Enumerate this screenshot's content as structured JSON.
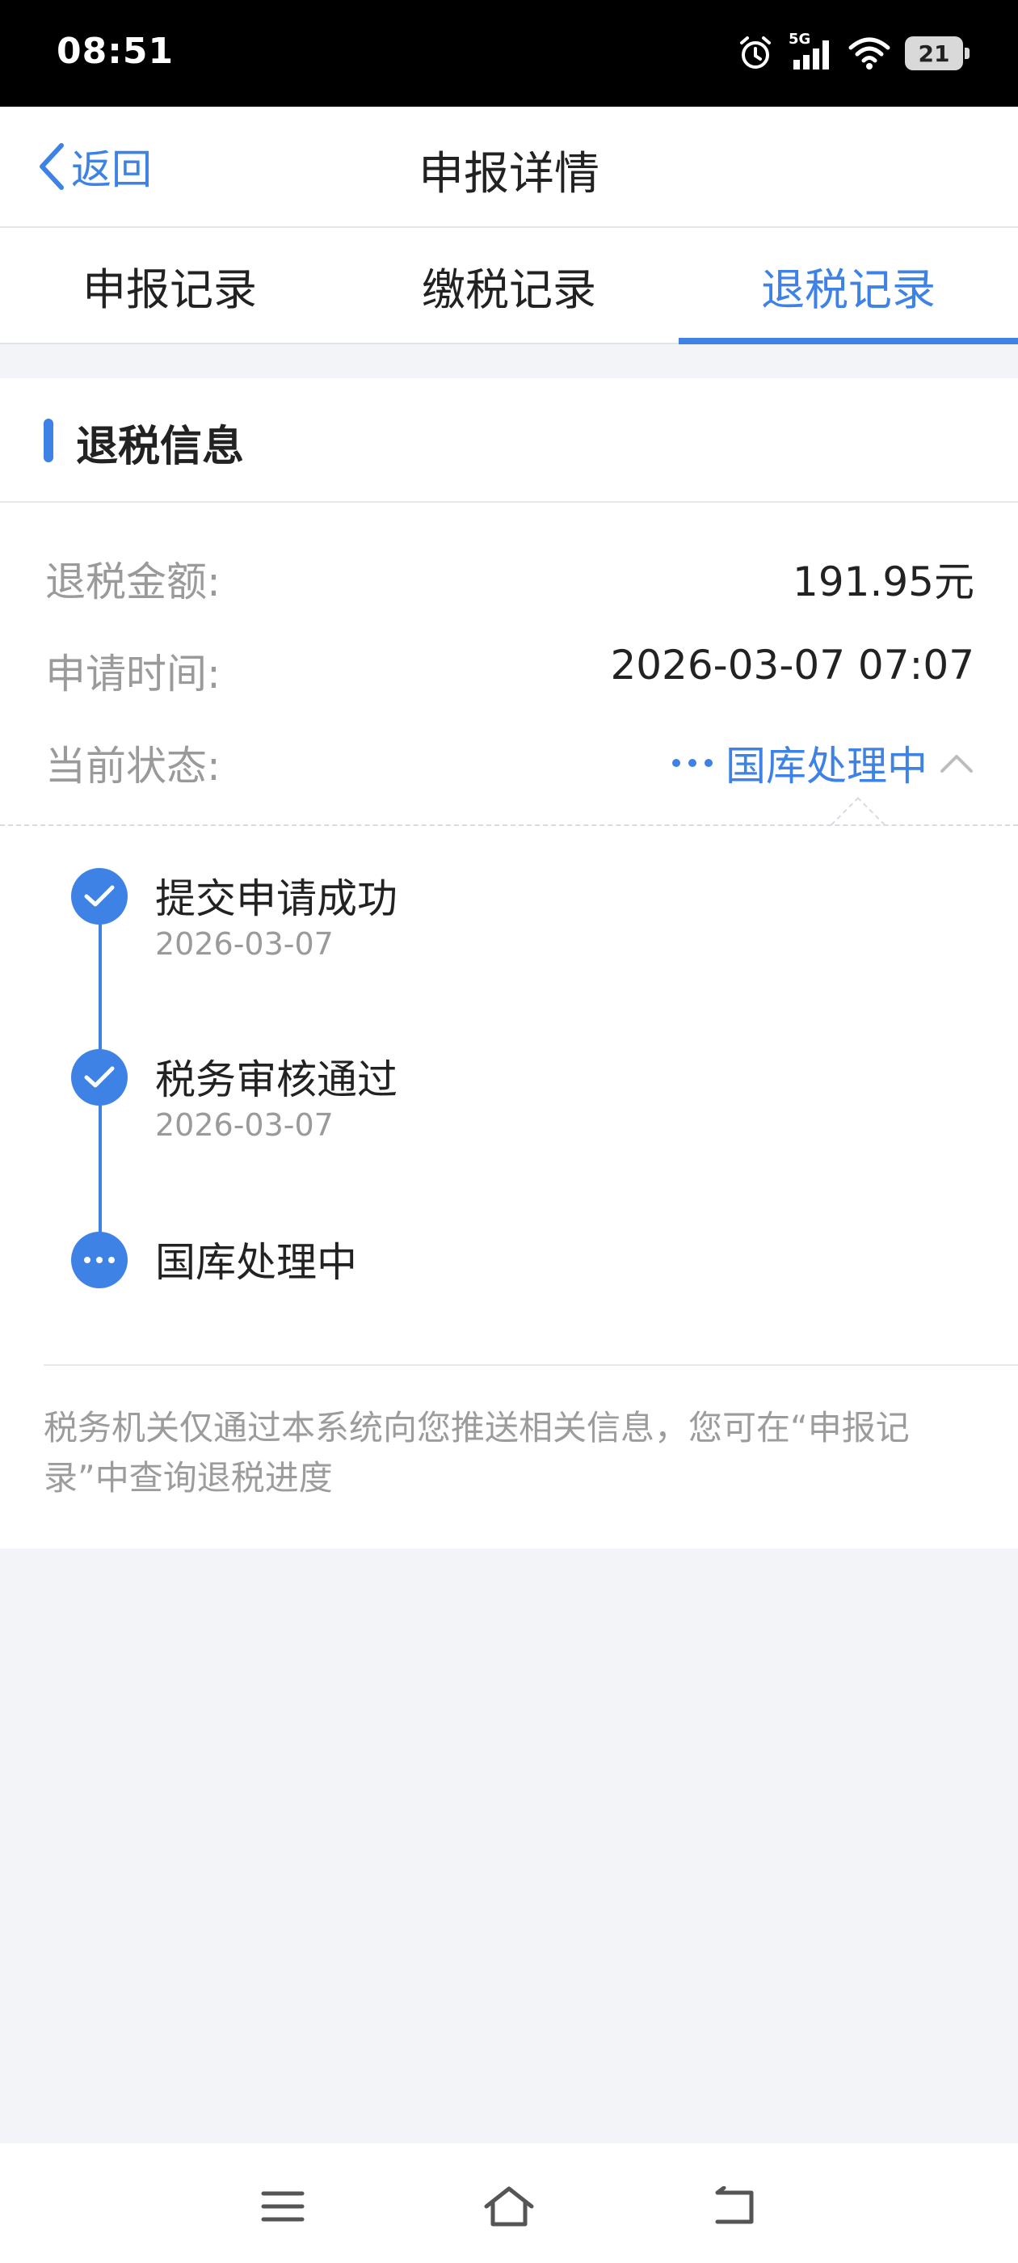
{
  "status_bar": {
    "time": "08:51",
    "network": "5G",
    "battery": "21"
  },
  "navbar": {
    "back_label": "返回",
    "title": "申报详情"
  },
  "tabs": [
    {
      "label": "申报记录",
      "active": false
    },
    {
      "label": "缴税记录",
      "active": false
    },
    {
      "label": "退税记录",
      "active": true
    }
  ],
  "card": {
    "title": "退税信息",
    "rows": [
      {
        "label": "退税金额:",
        "value": "191.95元"
      },
      {
        "label": "申请时间:",
        "value": "2026-03-07 07:07"
      },
      {
        "label": "当前状态:",
        "value": "国库处理中"
      }
    ],
    "timeline": [
      {
        "name": "提交申请成功",
        "date": "2026-03-07",
        "state": "done"
      },
      {
        "name": "税务审核通过",
        "date": "2026-03-07",
        "state": "done"
      },
      {
        "name": "国库处理中",
        "date": "",
        "state": "processing"
      }
    ],
    "note": "税务机关仅通过本系统向您推送相关信息，您可在“申报记录”中查询退税进度"
  },
  "colors": {
    "accent": "#3e82e6",
    "background": "#f3f4f8"
  }
}
